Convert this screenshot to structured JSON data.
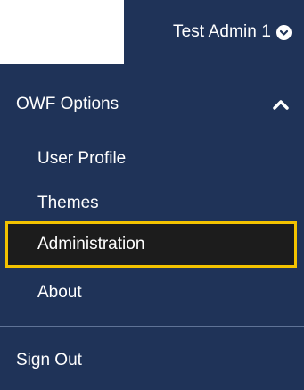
{
  "user_menu": {
    "user_name": "Test Admin 1",
    "toggle_icon": "chevron-down-circle-icon"
  },
  "dropdown": {
    "header_label": "OWF Options",
    "header_icon": "chevron-up-icon",
    "items": [
      {
        "label": "User Profile",
        "active": false
      },
      {
        "label": "Themes",
        "active": false
      },
      {
        "label": "Administration",
        "active": true
      },
      {
        "label": "About",
        "active": false
      }
    ],
    "signout_label": "Sign Out"
  },
  "colors": {
    "menu_bg": "#1f3358",
    "active_bg": "#1c1c1c",
    "active_border": "#f2c200",
    "text": "#ffffff",
    "divider": "#5f7396"
  }
}
